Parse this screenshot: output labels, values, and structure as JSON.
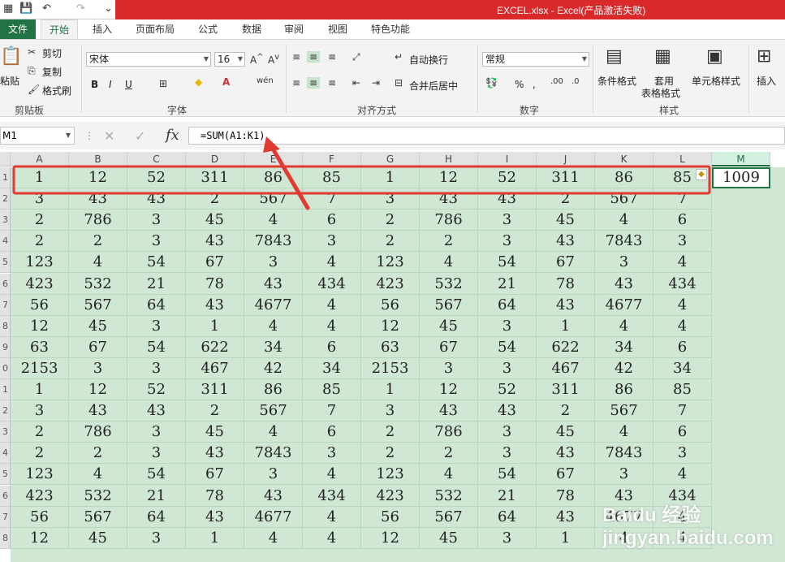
{
  "title": "EXCEL.xlsx -  Excel(产品激活失败)",
  "tabs": [
    "文件",
    "开始",
    "插入",
    "页面布局",
    "公式",
    "数据",
    "审阅",
    "视图",
    "特色功能"
  ],
  "ribbon": {
    "clipboard": {
      "paste": "粘贴",
      "cut": "剪切",
      "copy": "复制",
      "format_painter": "格式刷",
      "label": "剪贴板"
    },
    "font": {
      "name": "宋体",
      "size": "16",
      "label": "字体",
      "bold": "B",
      "italic": "I",
      "underline": "U"
    },
    "alignment": {
      "wrap": "自动换行",
      "merge": "合并后居中",
      "label": "对齐方式"
    },
    "number": {
      "format": "常规",
      "label": "数字",
      "percent": "%",
      "comma": ","
    },
    "styles": {
      "cond": "条件格式",
      "table1": "套用",
      "table2": "表格格式",
      "cell": "单元格样式",
      "label": "样式"
    },
    "cells": {
      "insert": "插入"
    }
  },
  "namebox": "M1",
  "formula": "=SUM(A1:K1)",
  "columns": [
    "A",
    "B",
    "C",
    "D",
    "E",
    "F",
    "G",
    "H",
    "I",
    "J",
    "K",
    "L",
    "M"
  ],
  "rows": [
    [
      "1",
      "12",
      "52",
      "311",
      "86",
      "85",
      "1",
      "12",
      "52",
      "311",
      "86",
      "85"
    ],
    [
      "3",
      "43",
      "43",
      "2",
      "567",
      "7",
      "3",
      "43",
      "43",
      "2",
      "567",
      "7"
    ],
    [
      "2",
      "786",
      "3",
      "45",
      "4",
      "6",
      "2",
      "786",
      "3",
      "45",
      "4",
      "6"
    ],
    [
      "2",
      "2",
      "3",
      "43",
      "7843",
      "3",
      "2",
      "2",
      "3",
      "43",
      "7843",
      "3"
    ],
    [
      "123",
      "4",
      "54",
      "67",
      "3",
      "4",
      "123",
      "4",
      "54",
      "67",
      "3",
      "4"
    ],
    [
      "423",
      "532",
      "21",
      "78",
      "43",
      "434",
      "423",
      "532",
      "21",
      "78",
      "43",
      "434"
    ],
    [
      "56",
      "567",
      "64",
      "43",
      "4677",
      "4",
      "56",
      "567",
      "64",
      "43",
      "4677",
      "4"
    ],
    [
      "12",
      "45",
      "3",
      "1",
      "4",
      "4",
      "12",
      "45",
      "3",
      "1",
      "4",
      "4"
    ],
    [
      "63",
      "67",
      "54",
      "622",
      "34",
      "6",
      "63",
      "67",
      "54",
      "622",
      "34",
      "6"
    ],
    [
      "2153",
      "3",
      "3",
      "467",
      "42",
      "34",
      "2153",
      "3",
      "3",
      "467",
      "42",
      "34"
    ],
    [
      "1",
      "12",
      "52",
      "311",
      "86",
      "85",
      "1",
      "12",
      "52",
      "311",
      "86",
      "85"
    ],
    [
      "3",
      "43",
      "43",
      "2",
      "567",
      "7",
      "3",
      "43",
      "43",
      "2",
      "567",
      "7"
    ],
    [
      "2",
      "786",
      "3",
      "45",
      "4",
      "6",
      "2",
      "786",
      "3",
      "45",
      "4",
      "6"
    ],
    [
      "2",
      "2",
      "3",
      "43",
      "7843",
      "3",
      "2",
      "2",
      "3",
      "43",
      "7843",
      "3"
    ],
    [
      "123",
      "4",
      "54",
      "67",
      "3",
      "4",
      "123",
      "4",
      "54",
      "67",
      "3",
      "4"
    ],
    [
      "423",
      "532",
      "21",
      "78",
      "43",
      "434",
      "423",
      "532",
      "21",
      "78",
      "43",
      "434"
    ],
    [
      "56",
      "567",
      "64",
      "43",
      "4677",
      "4",
      "56",
      "567",
      "64",
      "43",
      "4677",
      "4"
    ],
    [
      "12",
      "45",
      "3",
      "1",
      "4",
      "4",
      "12",
      "45",
      "3",
      "1",
      "4",
      "4"
    ]
  ],
  "m1_value": "1009",
  "colors": {
    "excel_green": "#217346",
    "title_red": "#d9292b",
    "highlight": "#e03a33",
    "sheet_tint": "#cfe7d3"
  },
  "watermark": "Baidu 经验 jingyan.baidu.com"
}
